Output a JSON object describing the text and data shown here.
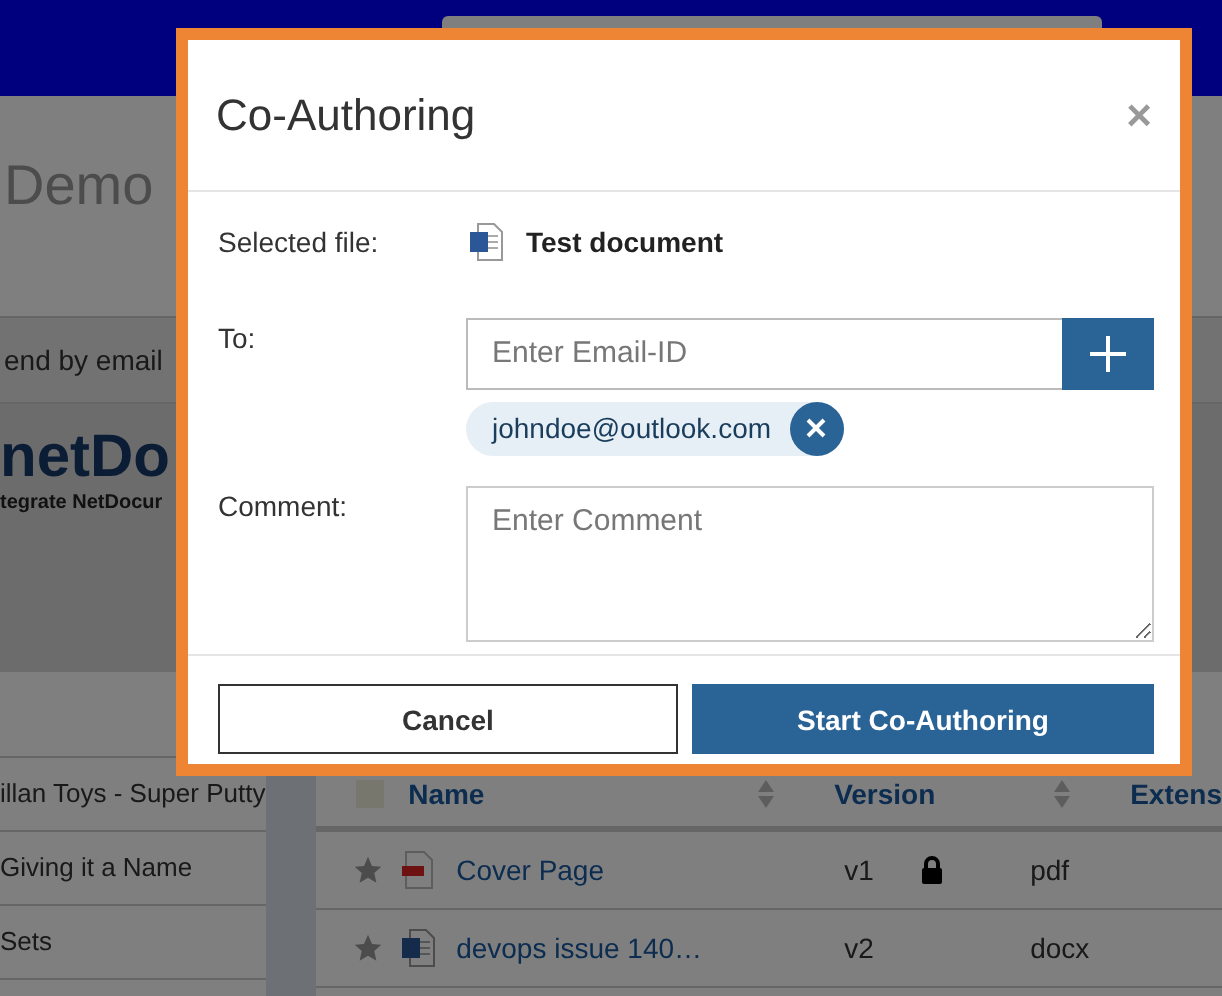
{
  "page": {
    "heading": "Demo",
    "action": "end by email",
    "logo": {
      "title": "netDo",
      "tagline": "tegrate NetDocur"
    },
    "sidebar_items": [
      "illan Toys - Super Putty",
      "Giving it a Name",
      "Sets"
    ],
    "table": {
      "select_all_checked": false,
      "columns": [
        "Name",
        "Version",
        "Extens"
      ],
      "rows": [
        {
          "name": "Cover Page",
          "kind": "pdf",
          "version": "v1",
          "locked": true,
          "extension": "pdf"
        },
        {
          "name": "devops issue 140…",
          "kind": "word",
          "version": "v2",
          "locked": false,
          "extension": "docx"
        }
      ]
    }
  },
  "dialog": {
    "title": "Co-Authoring",
    "close": "×",
    "selected_file_label": "Selected file:",
    "selected_file": "Test document",
    "to_label": "To:",
    "email_placeholder": "Enter Email-ID",
    "recipients": [
      {
        "email": "johndoe@outlook.com"
      }
    ],
    "comment_label": "Comment:",
    "comment_placeholder": "Enter Comment",
    "cancel": "Cancel",
    "submit": "Start Co-Authoring"
  }
}
